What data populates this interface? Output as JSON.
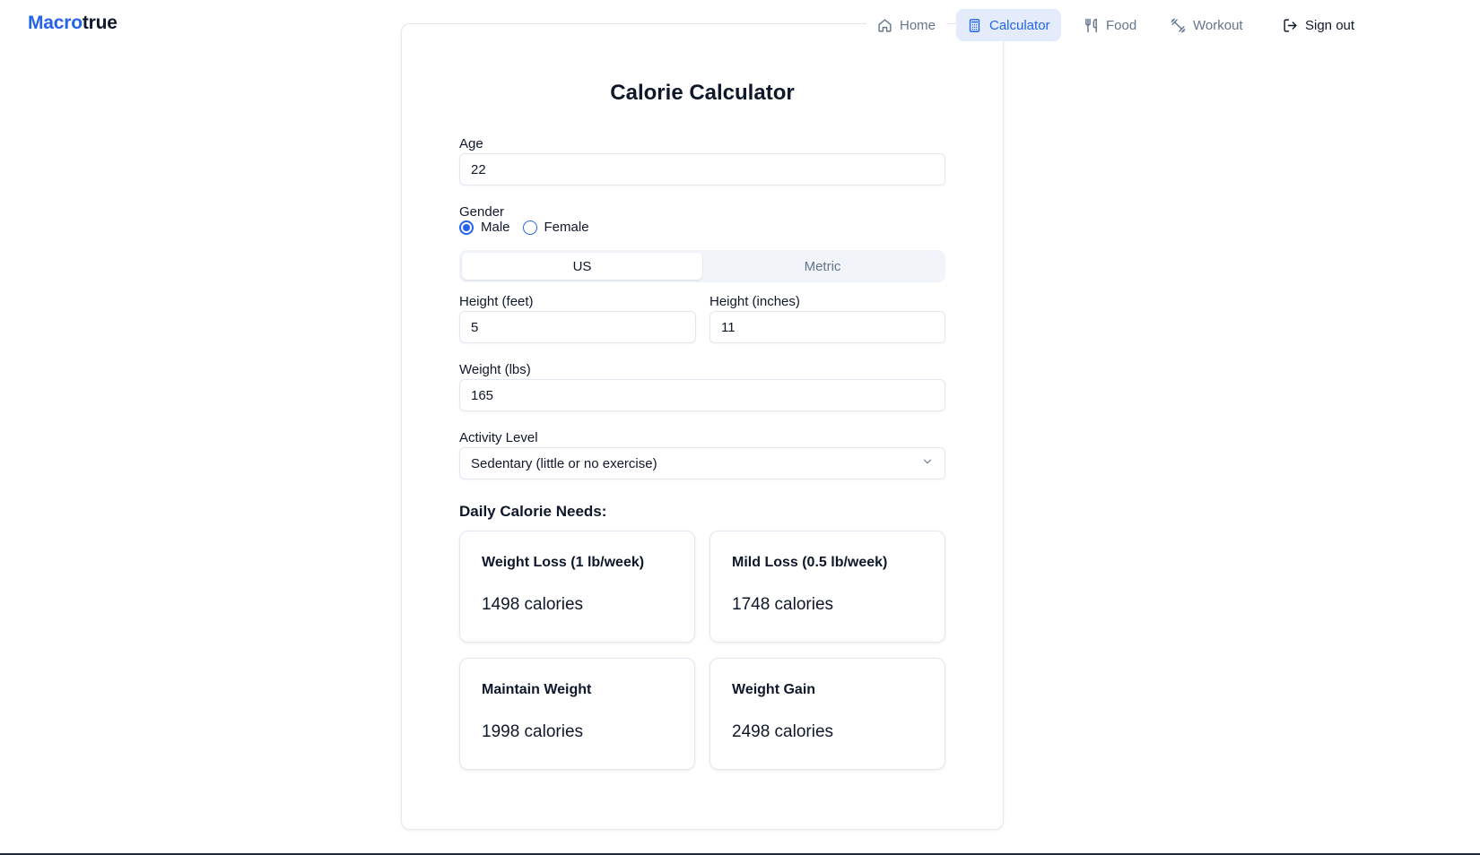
{
  "brand": {
    "part1": "Macro",
    "part2": "true"
  },
  "nav": {
    "home": "Home",
    "calculator": "Calculator",
    "food": "Food",
    "workout": "Workout",
    "signout": "Sign out"
  },
  "title": "Calorie Calculator",
  "age": {
    "label": "Age",
    "value": "22"
  },
  "gender": {
    "label": "Gender",
    "male": "Male",
    "female": "Female",
    "selected": "Male"
  },
  "units": {
    "us": "US",
    "metric": "Metric",
    "selected": "US"
  },
  "height_feet": {
    "label": "Height (feet)",
    "value": "5"
  },
  "height_inches": {
    "label": "Height (inches)",
    "value": "11"
  },
  "weight": {
    "label": "Weight (lbs)",
    "value": "165"
  },
  "activity": {
    "label": "Activity Level",
    "value": "Sedentary (little or no exercise)"
  },
  "results": {
    "title": "Daily Calorie Needs:",
    "items": [
      {
        "title": "Weight Loss (1 lb/week)",
        "value": "1498 calories"
      },
      {
        "title": "Mild Loss (0.5 lb/week)",
        "value": "1748 calories"
      },
      {
        "title": "Maintain Weight",
        "value": "1998 calories"
      },
      {
        "title": "Weight Gain",
        "value": "2498 calories"
      }
    ]
  },
  "colors": {
    "accent": "#2563eb",
    "active_nav_bg": "#e4ecfb",
    "text": "#0f172a",
    "muted": "#64748b",
    "border": "#e2e8f0"
  },
  "icons": {
    "home": "home-icon",
    "calculator": "calculator-icon",
    "food": "utensils-icon",
    "workout": "dumbbell-icon",
    "signout": "logout-icon",
    "select": "chevron-down-icon"
  }
}
